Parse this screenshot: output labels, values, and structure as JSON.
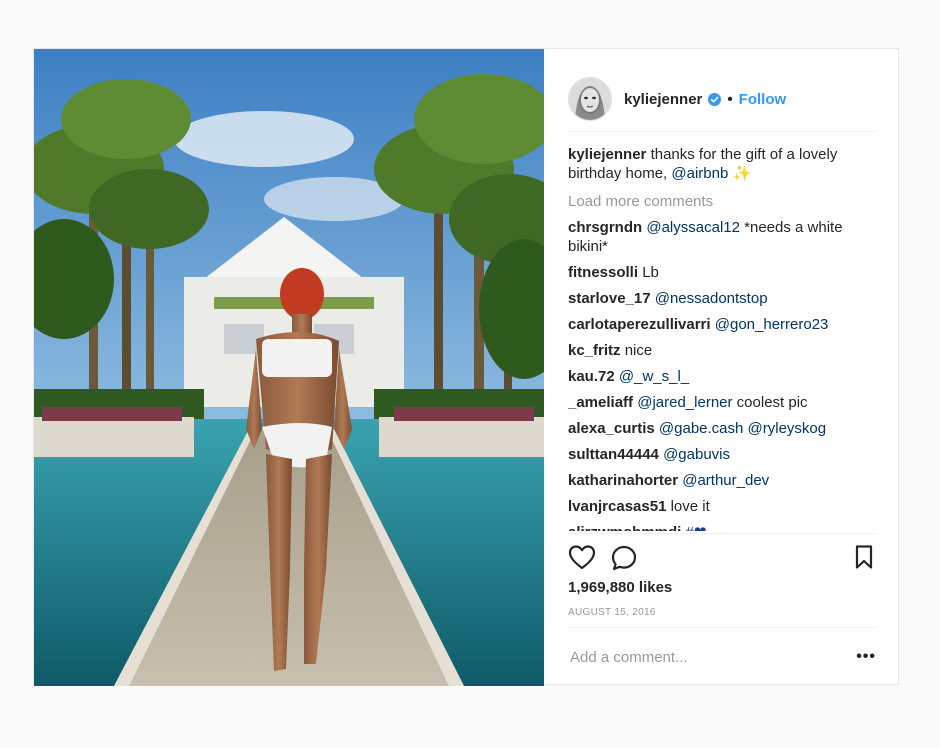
{
  "post": {
    "username": "kyliejenner",
    "separator": "•",
    "follow_label": "Follow",
    "caption": {
      "user": "kyliejenner",
      "text": "thanks for the gift of a lovely birthday home,",
      "mention": "@airbnb",
      "emoji": "✨"
    },
    "load_more": "Load more comments",
    "comments": [
      {
        "user": "chrsgrndn",
        "mention": "@alyssacal12",
        "text": "*needs a white bikini*"
      },
      {
        "user": "fitnessolli",
        "mention": "",
        "text": "Lb"
      },
      {
        "user": "starlove_17",
        "mention": "@nessadontstop",
        "text": ""
      },
      {
        "user": "carlotaperezullivarri",
        "mention": "@gon_herrero23",
        "text": ""
      },
      {
        "user": "kc_fritz",
        "mention": "",
        "text": "nice"
      },
      {
        "user": "kau.72",
        "mention": "@_w_s_l_",
        "text": ""
      },
      {
        "user": "_ameliaff",
        "mention": "@jared_lerner",
        "text": "coolest pic"
      },
      {
        "user": "alexa_curtis",
        "mention": "@gabe.cash @ryleyskog",
        "text": ""
      },
      {
        "user": "sulttan44444",
        "mention": "@gabuvis",
        "text": ""
      },
      {
        "user": "katharinahorter",
        "mention": "@arthur_dev",
        "text": ""
      },
      {
        "user": "lvanjrcasas51",
        "mention": "",
        "text": "love it"
      },
      {
        "user": "alirzwmohmmdi",
        "mention": "",
        "text": "#❤"
      }
    ],
    "likes": "1,969,880 likes",
    "date": "AUGUST 15, 2016",
    "add_comment_placeholder": "Add a comment...",
    "more_label": "•••",
    "icons": {
      "like": "heart-outline-icon",
      "comment": "speech-bubble-icon",
      "save": "bookmark-icon",
      "verified": "verified-badge-icon"
    },
    "colors": {
      "follow": "#3897f0",
      "mention": "#003569",
      "verified": "#3897f0"
    }
  }
}
